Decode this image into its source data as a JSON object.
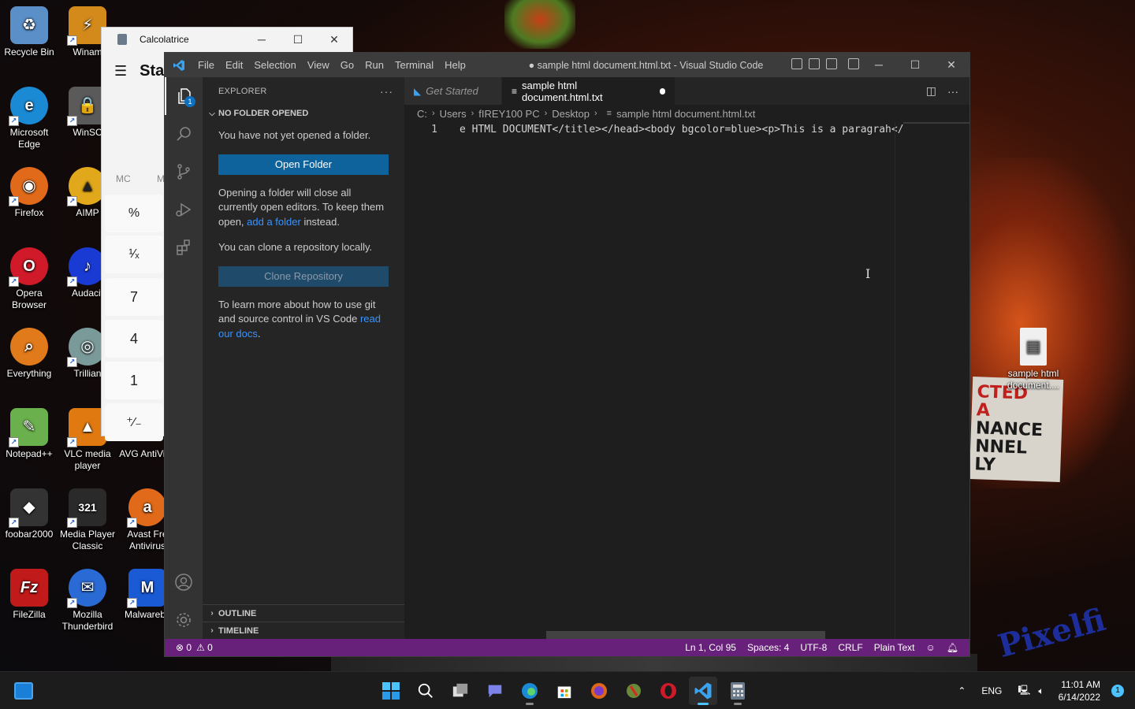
{
  "desktop": {
    "icons": [
      {
        "label": "Recycle Bin",
        "glyph": "♻",
        "color": "#5b8fc7"
      },
      {
        "label": "Winam",
        "glyph": "⚡",
        "color": "#d48a1a"
      },
      {
        "label": "Microsoft Edge",
        "glyph": "e",
        "color": "#1a8ad4"
      },
      {
        "label": "WinSC",
        "glyph": "🔒",
        "color": "#5a5a5a"
      },
      {
        "label": "Firefox",
        "glyph": "◉",
        "color": "#e06a1a"
      },
      {
        "label": "AIMP",
        "glyph": "▲",
        "color": "#e0a81a"
      },
      {
        "label": "Opera Browser",
        "glyph": "O",
        "color": "#d01a2a"
      },
      {
        "label": "Audacit",
        "glyph": "♪",
        "color": "#1a3ad4"
      },
      {
        "label": "Everything",
        "glyph": "⌕",
        "color": "#e07a1a"
      },
      {
        "label": "Trillian",
        "glyph": "◎",
        "color": "#7a9a9a"
      },
      {
        "label": "Notepad++",
        "glyph": "✎",
        "color": "#6ab04c"
      },
      {
        "label": "VLC media player",
        "glyph": "▲",
        "color": "#e07a10"
      },
      {
        "label": "AVG AntiVir...",
        "glyph": "",
        "color": "rgba(0,0,0,0)"
      },
      {
        "label": "foobar2000",
        "glyph": "◆",
        "color": "#333"
      },
      {
        "label": "Media Player Classic",
        "glyph": "321",
        "color": "#2a2a2a"
      },
      {
        "label": "Avast Fre Antivirus",
        "glyph": "a",
        "color": "#e06a1a"
      },
      {
        "label": "FileZilla",
        "glyph": "Fz",
        "color": "#c01a1a"
      },
      {
        "label": "Mozilla Thunderbird",
        "glyph": "✉",
        "color": "#2a6ad4"
      },
      {
        "label": "Malwareby",
        "glyph": "M",
        "color": "#1a5ad4"
      },
      {
        "label": "sample html document....",
        "glyph": "▤",
        "color": "#f0f0f0"
      }
    ],
    "sign_lines": [
      "CTED",
      "A",
      "NANCE",
      "NNEL",
      "LY"
    ]
  },
  "calculator": {
    "title": "Calcolatrice",
    "mode": "Star",
    "mem": [
      "MC",
      "M"
    ],
    "buttons": [
      "%",
      "¹⁄ₓ",
      "7",
      "4",
      "1",
      "⁺⁄₋"
    ]
  },
  "vscode": {
    "menu": [
      "File",
      "Edit",
      "Selection",
      "View",
      "Go",
      "Run",
      "Terminal",
      "Help"
    ],
    "window_title": "● sample html document.html.txt - Visual Studio Code",
    "explorer": {
      "header": "EXPLORER",
      "section": "NO FOLDER OPENED",
      "msg1": "You have not yet opened a folder.",
      "open_folder": "Open Folder",
      "msg2_a": "Opening a folder will close all currently open editors. To keep them open, ",
      "msg2_link": "add a folder",
      "msg2_b": " instead.",
      "msg3": "You can clone a repository locally.",
      "clone": "Clone Repository",
      "msg4_a": "To learn more about how to use git and source control in VS Code ",
      "msg4_link": "read our docs",
      "msg4_b": ".",
      "outline": "OUTLINE",
      "timeline": "TIMELINE"
    },
    "tabs": {
      "get_started": "Get Started",
      "file": "sample html document.html.txt"
    },
    "breadcrumb": [
      "C:",
      "Users",
      "fIREY100 PC",
      "Desktop",
      "sample html document.html.txt"
    ],
    "code": {
      "line_no": "1",
      "text": "e HTML DOCUMENT</title></head><body bgcolor=blue><p>This is a paragrah</"
    },
    "status": {
      "errors": "⊗ 0",
      "warnings": "⚠ 0",
      "position": "Ln 1, Col 95",
      "spaces": "Spaces: 4",
      "encoding": "UTF-8",
      "eol": "CRLF",
      "language": "Plain Text"
    },
    "explorer_badge": "1"
  },
  "taskbar": {
    "lang": "ENG",
    "time": "11:01 AM",
    "date": "6/14/2022",
    "notifications": "1",
    "apps": [
      "start-icon",
      "search-icon",
      "task-view-icon",
      "chat-icon",
      "edge-icon",
      "store-icon",
      "firefox-icon",
      "winamp-icon",
      "opera-icon",
      "vscode-icon",
      "calculator-icon"
    ]
  }
}
